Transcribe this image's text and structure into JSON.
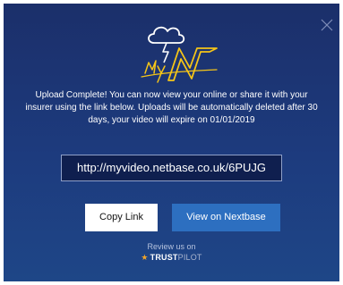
{
  "dialog": {
    "message": "Upload Complete! You can now view your online or share it with your insurer using the link below. Uploads will be automatically deleted after 30 days, your video will expire on 01/01/2019",
    "video_link": "http://myvideo.netbase.co.uk/6PUJG",
    "copy_label": "Copy Link",
    "view_label": "View on Nextbase",
    "review_label": "Review us on",
    "trustpilot": {
      "star": "★",
      "trust": "TRUST",
      "pilot": "PILOT"
    }
  },
  "colors": {
    "background_top": "#1b2f6a",
    "background_bottom": "#1e4687",
    "accent_yellow": "#f5c518",
    "view_button": "#2d6fc0",
    "copy_button": "#ffffff",
    "trustpilot_star": "#f1a52a"
  },
  "icons": {
    "close": "close-icon",
    "logo": "my-nextbase-cloud-logo"
  }
}
